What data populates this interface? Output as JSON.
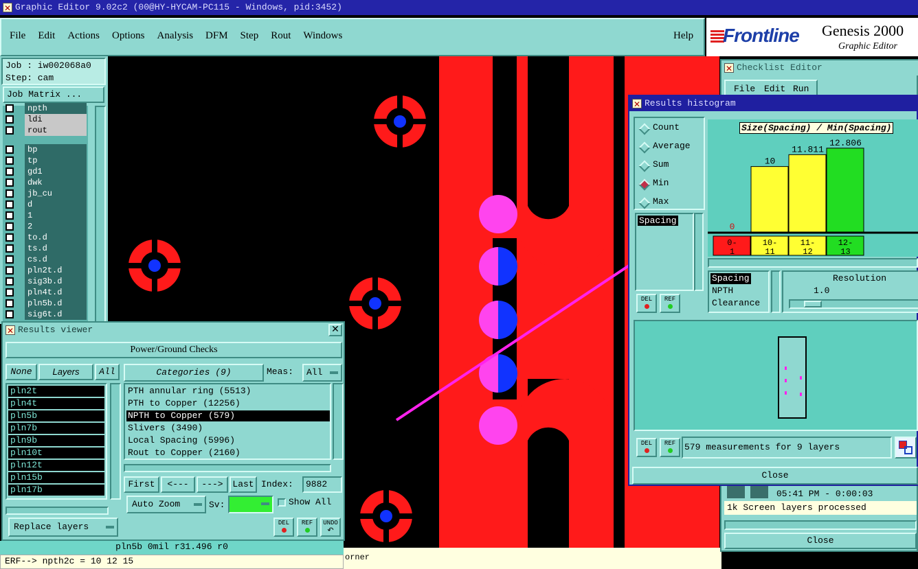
{
  "main_window": {
    "title": "Graphic Editor 9.02c2 (00@HY-HYCAM-PC115 - Windows, pid:3452)"
  },
  "menu": {
    "items": [
      "File",
      "Edit",
      "Actions",
      "Options",
      "Analysis",
      "DFM",
      "Step",
      "Rout",
      "Windows"
    ],
    "help": "Help"
  },
  "brand": {
    "logo": "Frontline",
    "product": "Genesis 2000",
    "subtitle": "Graphic Editor"
  },
  "job_panel": {
    "job": "Job : iw002068a0",
    "step": "Step: cam",
    "matrix_button": "Job Matrix ...",
    "layers_top": [
      "npth",
      "ldi",
      "rout"
    ],
    "layers": [
      "bp",
      "tp",
      "gd1",
      "dwk",
      "jb_cu",
      "d",
      "1",
      "2",
      "to.d",
      "ts.d",
      "cs.d",
      "pln2t.d",
      "sig3b.d",
      "pln4t.d",
      "pln5b.d",
      "sig6t.d"
    ]
  },
  "results_viewer": {
    "title": "Results viewer",
    "header": "Power/Ground Checks",
    "none_label": "None",
    "layers_label": "Layers",
    "all_label": "All",
    "categories_label": "Categories (9)",
    "meas_label": "Meas:",
    "meas_value": "All",
    "layers": [
      "pln2t",
      "pln4t",
      "pln5b",
      "pln7b",
      "pln9b",
      "pln10t",
      "pln12t",
      "pln15b",
      "pln17b"
    ],
    "categories": [
      "PTH annular ring (5513)",
      "PTH to Copper (12256)",
      "NPTH to Copper (579)",
      "Slivers (3490)",
      "Local Spacing (5996)",
      "Rout to Copper (2160)"
    ],
    "selected_category": "NPTH to Copper (579)",
    "nav": {
      "first": "First",
      "prev": "<---",
      "next": "--->",
      "last": "Last",
      "index_label": "Index:",
      "index_value": "9882"
    },
    "auto_zoom": "Auto Zoom",
    "sv_label": "Sv:",
    "show_all": "Show All",
    "replace_layers": "Replace layers",
    "del": "DEL",
    "ref": "REF",
    "undo": "UNDO"
  },
  "status": {
    "line1": "pln5b 0mil  r31.496  r0",
    "line2": "ERF--> npth2c = 10 12 15",
    "tail": "orner"
  },
  "checklist": {
    "title": "Checklist Editor",
    "menu": [
      "File",
      "Edit",
      "Run"
    ],
    "time": "05:41 PM - 0:00:03",
    "message": "1k Screen layers processed",
    "close": "Close"
  },
  "histogram": {
    "title": "Results histogram",
    "modes": [
      "Count",
      "Average",
      "Sum",
      "Min",
      "Max"
    ],
    "selected_mode": "Min",
    "list_selected": "Spacing",
    "chart_title": "Size(Spacing) / Min(Spacing)",
    "measure_list": [
      "Spacing",
      "NPTH",
      "Clearance"
    ],
    "resolution_label": "Resolution",
    "resolution_value": "1.0",
    "summary": "579 measurements for 9 layers",
    "close": "Close",
    "del": "DEL",
    "ref": "REF",
    "colors": {
      "red": "#ff1a1a",
      "yellow": "#ffff33",
      "green": "#22dd22"
    }
  },
  "chart_data": {
    "type": "bar",
    "title": "Size(Spacing) / Min(Spacing)",
    "categories": [
      "0-1",
      "10-11",
      "11-12",
      "12-13"
    ],
    "category_lines": [
      [
        "0-",
        "1"
      ],
      [
        "10-",
        "11"
      ],
      [
        "11-",
        "12"
      ],
      [
        "12-",
        "13"
      ]
    ],
    "values": [
      0,
      10,
      11.811,
      12.806
    ],
    "value_labels": [
      "0",
      "10",
      "11.811",
      "12.806"
    ],
    "colors": [
      "#ff1a1a",
      "#ffff33",
      "#ffff33",
      "#22dd22"
    ],
    "ylim": [
      0,
      13
    ]
  }
}
